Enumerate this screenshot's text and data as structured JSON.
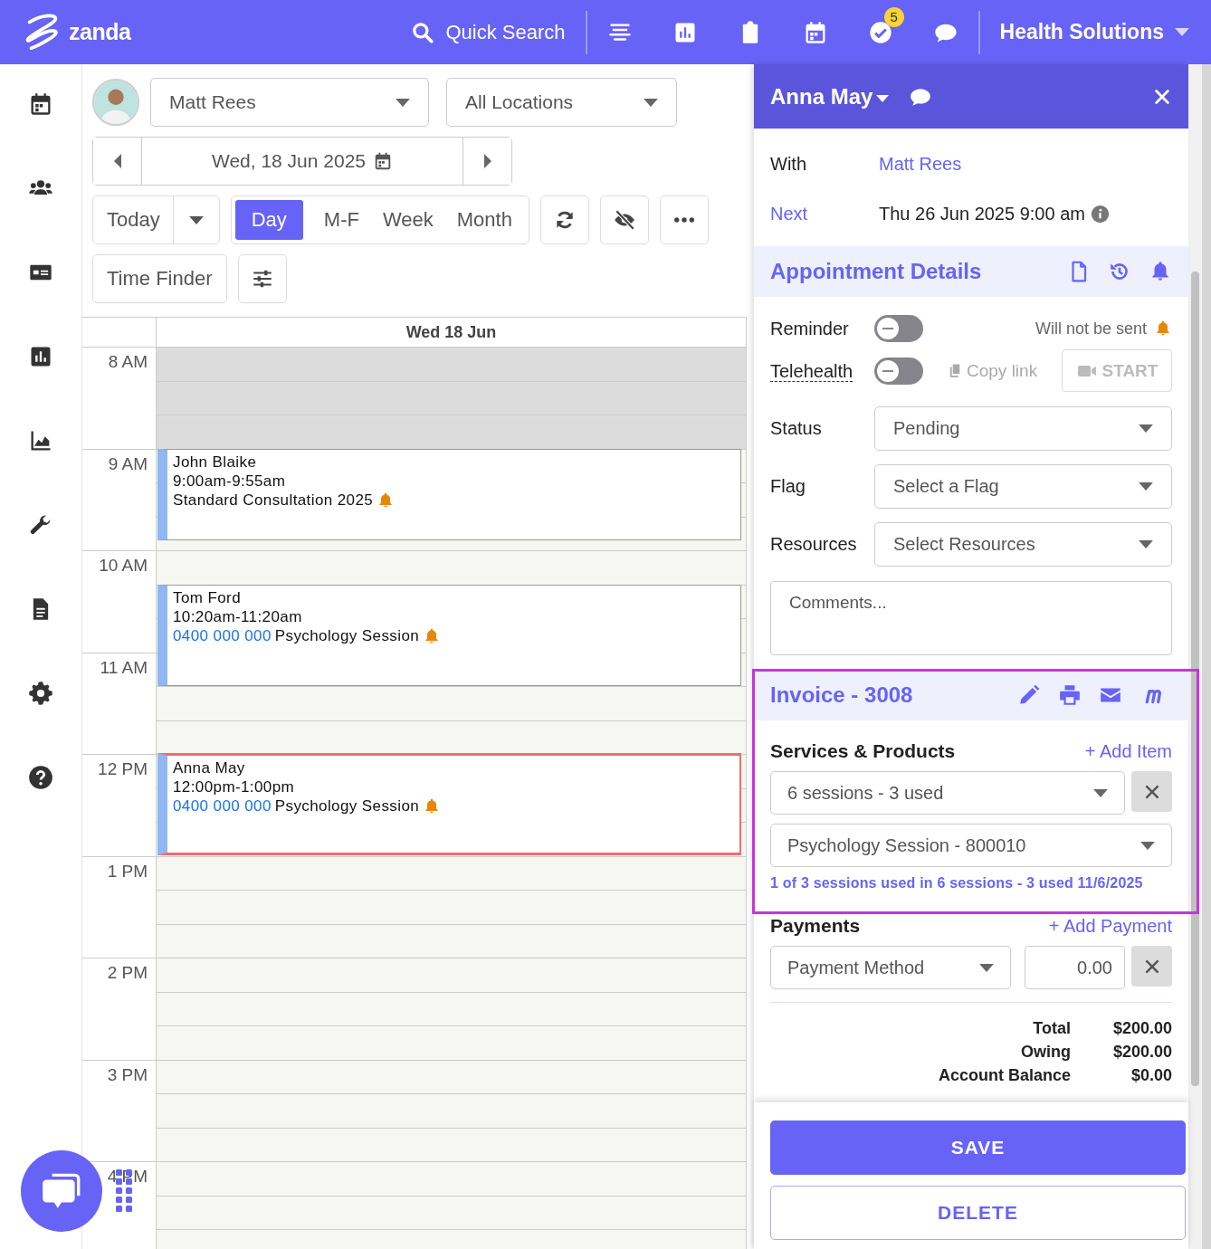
{
  "topbar": {
    "logo": "zanda",
    "search": "Quick Search",
    "icons": [
      {
        "kind": "lines"
      },
      {
        "kind": "chart"
      },
      {
        "kind": "clipboard"
      },
      {
        "kind": "calendar"
      },
      {
        "kind": "check",
        "badge": "5"
      },
      {
        "kind": "chat"
      }
    ],
    "organisation": "Health Solutions"
  },
  "sidebar": {
    "items": [
      {
        "kind": "calendar"
      },
      {
        "kind": "users"
      },
      {
        "kind": "billing"
      },
      {
        "kind": "chart"
      },
      {
        "kind": "area"
      },
      {
        "kind": "wrench"
      },
      {
        "kind": "document"
      },
      {
        "kind": "gear"
      },
      {
        "kind": "help"
      }
    ]
  },
  "calendar": {
    "practitioner": "Matt Rees",
    "location": "All Locations",
    "date": "Wed, 18 Jun 2025",
    "today": "Today",
    "views": [
      {
        "label": "Day",
        "selected": true
      },
      {
        "label": "M-F",
        "selected": false
      },
      {
        "label": "Week",
        "selected": false
      },
      {
        "label": "Month",
        "selected": false
      }
    ],
    "time_finder": "Time Finder",
    "column_header": "Wed 18 Jun",
    "hours": [
      {
        "label": "8 AM",
        "unavailable": true
      },
      {
        "label": "9 AM",
        "unavailable": false
      },
      {
        "label": "10 AM",
        "unavailable": false
      },
      {
        "label": "11 AM",
        "unavailable": false
      },
      {
        "label": "12 PM",
        "unavailable": false
      },
      {
        "label": "1 PM",
        "unavailable": false
      },
      {
        "label": "2 PM",
        "unavailable": false
      },
      {
        "label": "3 PM",
        "unavailable": false
      },
      {
        "label": "4 PM",
        "unavailable": false
      }
    ],
    "appointments": [
      {
        "client": "John Blaike",
        "time": "9:00am-9:55am",
        "service": "Standard Consultation 2025",
        "reminder": true,
        "selected": false
      },
      {
        "client": "Tom Ford",
        "time": "10:20am-11:20am",
        "phone": "0400 000 000",
        "service": "Psychology Session",
        "reminder": true,
        "selected": false
      },
      {
        "client": "Anna May",
        "time": "12:00pm-1:00pm",
        "phone": "0400 000 000",
        "service": "Psychology Session",
        "reminder": true,
        "selected": true
      }
    ]
  },
  "panel": {
    "client": "Anna May",
    "details": [
      {
        "label": "With",
        "value": "Matt Rees",
        "kind": "link-value"
      },
      {
        "label": "Next",
        "value": "Thu 26 Jun 2025 9:00 am",
        "kind": "link-label"
      }
    ],
    "appointment_details": {
      "title": "Appointment Details",
      "reminder": {
        "label": "Reminder",
        "on": false,
        "note": "Will not be sent"
      },
      "telehealth": {
        "label": "Telehealth",
        "on": false,
        "copy_link": "Copy link",
        "start": "START",
        "disabled": true
      },
      "fields": [
        {
          "label": "Status",
          "value": "Pending"
        },
        {
          "label": "Flag",
          "placeholder": "Select a Flag"
        },
        {
          "label": "Resources",
          "placeholder": "Select Resources"
        }
      ],
      "comments": {
        "placeholder": "Comments..."
      }
    },
    "invoice": {
      "title": "Invoice - 3008",
      "highlighted": true,
      "services_label": "Services & Products",
      "add_item": "+ Add Item",
      "items": [
        {
          "value": "6 sessions - 3 used",
          "removable": true
        },
        {
          "value": "Psychology Session - 800010",
          "removable": false
        }
      ],
      "note": "1 of 3 sessions used in 6 sessions - 3 used 11/6/2025",
      "payments_label": "Payments",
      "add_payment": "+ Add Payment",
      "payment_method": {
        "placeholder": "Payment Method"
      },
      "amount": "0.00",
      "totals": [
        {
          "label": "Total",
          "value": "$200.00"
        },
        {
          "label": "Owing",
          "value": "$200.00"
        },
        {
          "label": "Account Balance",
          "value": "$0.00"
        }
      ]
    },
    "buttons": {
      "save": "SAVE",
      "delete": "DELETE"
    }
  }
}
